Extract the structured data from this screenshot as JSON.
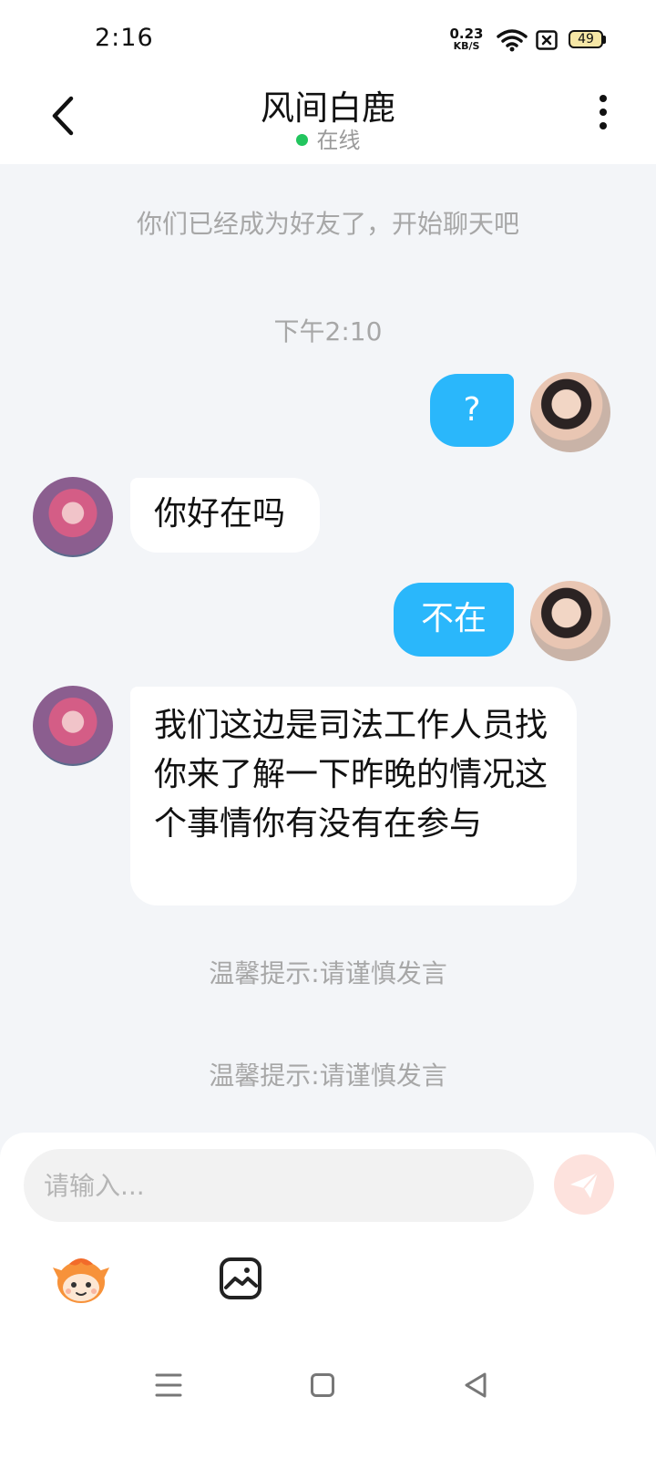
{
  "status_bar": {
    "time": "2:16",
    "net_speed_value": "0.23",
    "net_speed_unit": "KB/S",
    "battery_level": "49",
    "icons": [
      "wifi-icon",
      "sim-blocked-icon",
      "battery-icon"
    ]
  },
  "header": {
    "title": "风间白鹿",
    "status": "在线",
    "status_color": "#22c55e",
    "icons": [
      "back-chevron-icon",
      "more-vertical-icon"
    ]
  },
  "chat": {
    "system_notice": "你们已经成为好友了，开始聊天吧",
    "timestamp": "下午2:10",
    "messages": [
      {
        "from": "self",
        "text": "?"
      },
      {
        "from": "other",
        "text": "你好在吗"
      },
      {
        "from": "self",
        "text": "不在"
      },
      {
        "from": "other",
        "text": "我们这边是司法工作人员找你来了解一下昨晚的情况这个事情你有没有在参与"
      }
    ],
    "tips": [
      "温馨提示:请谨慎发言",
      "温馨提示:请谨慎发言"
    ],
    "bubble_color_out": "#2ab7fb",
    "bubble_color_in": "#ffffff"
  },
  "input": {
    "placeholder": "请输入...",
    "value": "",
    "icons": [
      "send-icon",
      "emoji-icon",
      "image-icon"
    ]
  },
  "nav_bar": {
    "icons": [
      "menu-icon",
      "home-icon",
      "back-triangle-icon"
    ]
  }
}
